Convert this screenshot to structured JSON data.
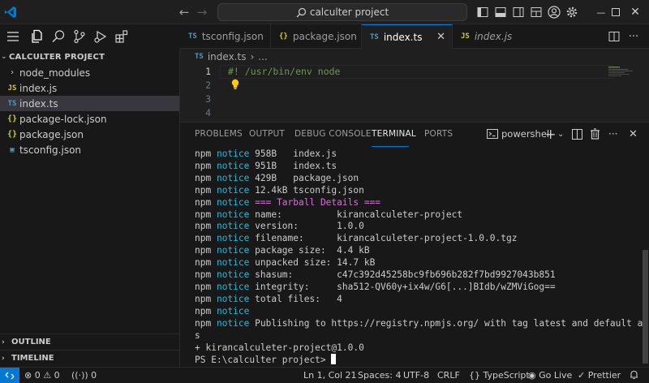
{
  "colors": {
    "accent": "#0078d4",
    "ts_icon": "#519aba",
    "js_icon": "#cbcb41",
    "notice": "#29b8db",
    "heading": "#d670d6",
    "comment": "#6a9955"
  },
  "titlebar": {
    "search_text": "calculter project",
    "icons": [
      "back-arrow-icon",
      "forward-arrow-icon",
      "search-icon",
      "toggle-sidebar-icon",
      "toggle-panel-icon",
      "toggle-secondary-sidebar-icon",
      "customize-layout-icon",
      "account-icon",
      "settings-gear-icon"
    ],
    "window_controls": [
      "minimize",
      "restore",
      "close"
    ]
  },
  "activity_icons": [
    "menu-icon",
    "explorer-icon",
    "search-icon",
    "source-control-icon",
    "run-debug-icon",
    "extensions-icon"
  ],
  "sidebar": {
    "title": "CALCULTER PROJECT",
    "items": [
      {
        "label": "node_modules",
        "icon": "folder-chevron-icon",
        "glyph": "›"
      },
      {
        "label": "index.js",
        "icon": "js-file-icon",
        "glyph": "JS"
      },
      {
        "label": "index.ts",
        "icon": "ts-file-icon",
        "glyph": "TS"
      },
      {
        "label": "package-lock.json",
        "icon": "json-file-icon",
        "glyph": "{}"
      },
      {
        "label": "package.json",
        "icon": "json-file-icon",
        "glyph": "{}"
      },
      {
        "label": "tsconfig.json",
        "icon": "tsconfig-file-icon",
        "glyph": "▣"
      }
    ],
    "outline": "OUTLINE",
    "timeline": "TIMELINE"
  },
  "tabs": [
    {
      "label": "tsconfig.json",
      "glyph": "TS"
    },
    {
      "label": "package.json",
      "glyph": "{}"
    },
    {
      "label": "index.ts",
      "glyph": "TS"
    },
    {
      "label": "index.js",
      "glyph": "JS"
    }
  ],
  "breadcrumb": {
    "glyph": "TS",
    "file": "index.ts",
    "sep": "›",
    "more": "..."
  },
  "editor": {
    "line_numbers": [
      "1",
      "2",
      "3",
      "4"
    ],
    "line1": "#! /usr/bin/env node"
  },
  "panel": {
    "tabs": [
      "PROBLEMS",
      "OUTPUT",
      "DEBUG CONSOLE",
      "TERMINAL",
      "PORTS"
    ],
    "shell": "powershell",
    "terminal": {
      "npm": "npm",
      "notice": "notice",
      "lines": [
        " 958B   index.js",
        " 951B   index.ts",
        " 429B   package.json",
        " 12.4kB tsconfig.json",
        "",
        " name:          kirancalculeter-project",
        " version:       1.0.0",
        " filename:      kirancalculeter-project-1.0.0.tgz",
        " package size:  4.4 kB",
        " unpacked size: 14.7 kB",
        " shasum:        c47c392d45258bc9fb696b282f7bd9927043b851",
        " integrity:     sha512-QV60y+ix4w/G6[...]BIdb/wZMViGog==",
        " total files:   4",
        "",
        " Publishing to https://registry.npmjs.org/ with tag latest and default acces"
      ],
      "tarball_heading": " === Tarball Details ===",
      "wrap": "s",
      "result": "+ kirancalculeter-project@1.0.0",
      "prompt": "PS E:\\calculter project> "
    }
  },
  "statusbar": {
    "errors": "0",
    "warnings": "0",
    "ports": "0",
    "position": "Ln 1, Col 21",
    "spaces": "Spaces: 4",
    "encoding": "UTF-8",
    "eol": "CRLF",
    "language": "TypeScript",
    "golive": "Go Live",
    "prettier": "Prettier"
  }
}
